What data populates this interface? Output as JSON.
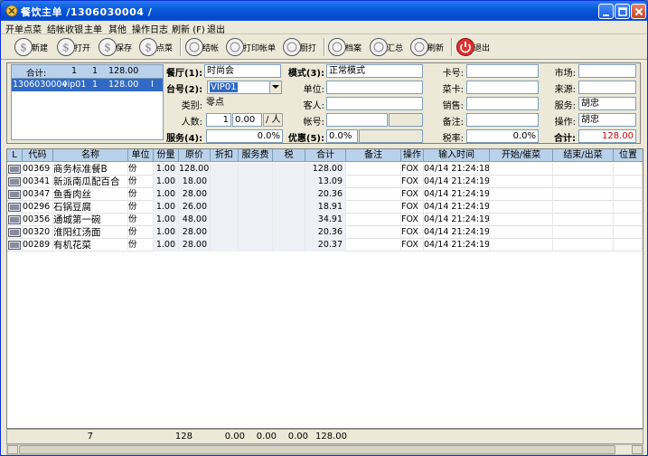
{
  "window": {
    "title": "餐饮主单 /1306030004 /"
  },
  "menu": [
    "开单点菜",
    "结帐收银",
    "主单",
    "其他",
    "操作日志",
    "刷新 (F)",
    "退出"
  ],
  "toolbar": {
    "new": "新建",
    "open": "打开",
    "save": "保存",
    "order": "点菜",
    "checkout": "结帐",
    "print": "打印帐单",
    "kitchen": "厨打",
    "archive": "档案",
    "summary": "汇总",
    "refresh": "刷新",
    "exit": "退出"
  },
  "order_list": {
    "summary": {
      "label": "合计:",
      "count1": "1",
      "count2": "1",
      "amount": "128.00"
    },
    "rows": [
      {
        "id": "1306030004",
        "table": "vip01",
        "guests": "1",
        "amount": "128.00",
        "flag": "I"
      }
    ]
  },
  "form": {
    "restaurant_label": "餐厅(1):",
    "restaurant": "时尚会",
    "table_label": "台号(2):",
    "table": "VIP01",
    "category_label": "类别:",
    "category": "零点",
    "guests_label": "人数:",
    "guests": "1",
    "per_person": "0.00",
    "per_unit": "/ 人",
    "service_label": "服务(4):",
    "service": "0.0%",
    "mode_label": "模式(3):",
    "mode": "正常模式",
    "unit_label": "单位:",
    "unit": "",
    "guest_label": "客人:",
    "guest": "",
    "account_label": "帐号:",
    "account": "",
    "discount_label": "优惠(5):",
    "discount": "0.0%",
    "card_label": "卡号:",
    "card": "",
    "member_label": "菜卡:",
    "member": "",
    "sales_label": "销售:",
    "sales": "",
    "remark_label": "备注:",
    "remark": "",
    "taxrate_label": "税率:",
    "taxrate": "0.0%",
    "market_label": "市场:",
    "market": "",
    "source_label": "来源:",
    "source": "",
    "server_label": "服务:",
    "server": "胡忠",
    "operator_label": "操作:",
    "operator": "胡忠",
    "total_label": "合计:",
    "total": "128.00"
  },
  "grid": {
    "headers": [
      "L",
      "代码",
      "名称",
      "单位",
      "份量",
      "原价",
      "折扣",
      "服务费",
      "税",
      "合计",
      "备注",
      "操作",
      "输入时间",
      "开始/催菜",
      "结束/出菜",
      "位置"
    ],
    "rows": [
      {
        "code": "00369",
        "name": "商务标准餐B",
        "unit": "份",
        "qty": "1.00",
        "price": "128.00",
        "total": "128.00",
        "op": "FOX",
        "time": "04/14 21:24:18"
      },
      {
        "code": "00341",
        "name": "新派南瓜配百合",
        "unit": "份",
        "qty": "1.00",
        "price": "18.00",
        "total": "13.09",
        "op": "FOX",
        "time": "04/14 21:24:19"
      },
      {
        "code": "00347",
        "name": "鱼香肉丝",
        "unit": "份",
        "qty": "1.00",
        "price": "28.00",
        "total": "20.36",
        "op": "FOX",
        "time": "04/14 21:24:19"
      },
      {
        "code": "00296",
        "name": "石锅豆腐",
        "unit": "份",
        "qty": "1.00",
        "price": "26.00",
        "total": "18.91",
        "op": "FOX",
        "time": "04/14 21:24:19"
      },
      {
        "code": "00356",
        "name": "通城第一碗",
        "unit": "份",
        "qty": "1.00",
        "price": "48.00",
        "total": "34.91",
        "op": "FOX",
        "time": "04/14 21:24:19"
      },
      {
        "code": "00320",
        "name": "淮阳红汤面",
        "unit": "份",
        "qty": "1.00",
        "price": "28.00",
        "total": "20.36",
        "op": "FOX",
        "time": "04/14 21:24:19"
      },
      {
        "code": "00289",
        "name": "有机花菜",
        "unit": "份",
        "qty": "1.00",
        "price": "28.00",
        "total": "20.37",
        "op": "FOX",
        "time": "04/14 21:24:19"
      }
    ],
    "footer": {
      "count": "7",
      "price": "128",
      "disc": "0.00",
      "fee": "0.00",
      "tax": "0.00",
      "total": "128.00"
    }
  }
}
